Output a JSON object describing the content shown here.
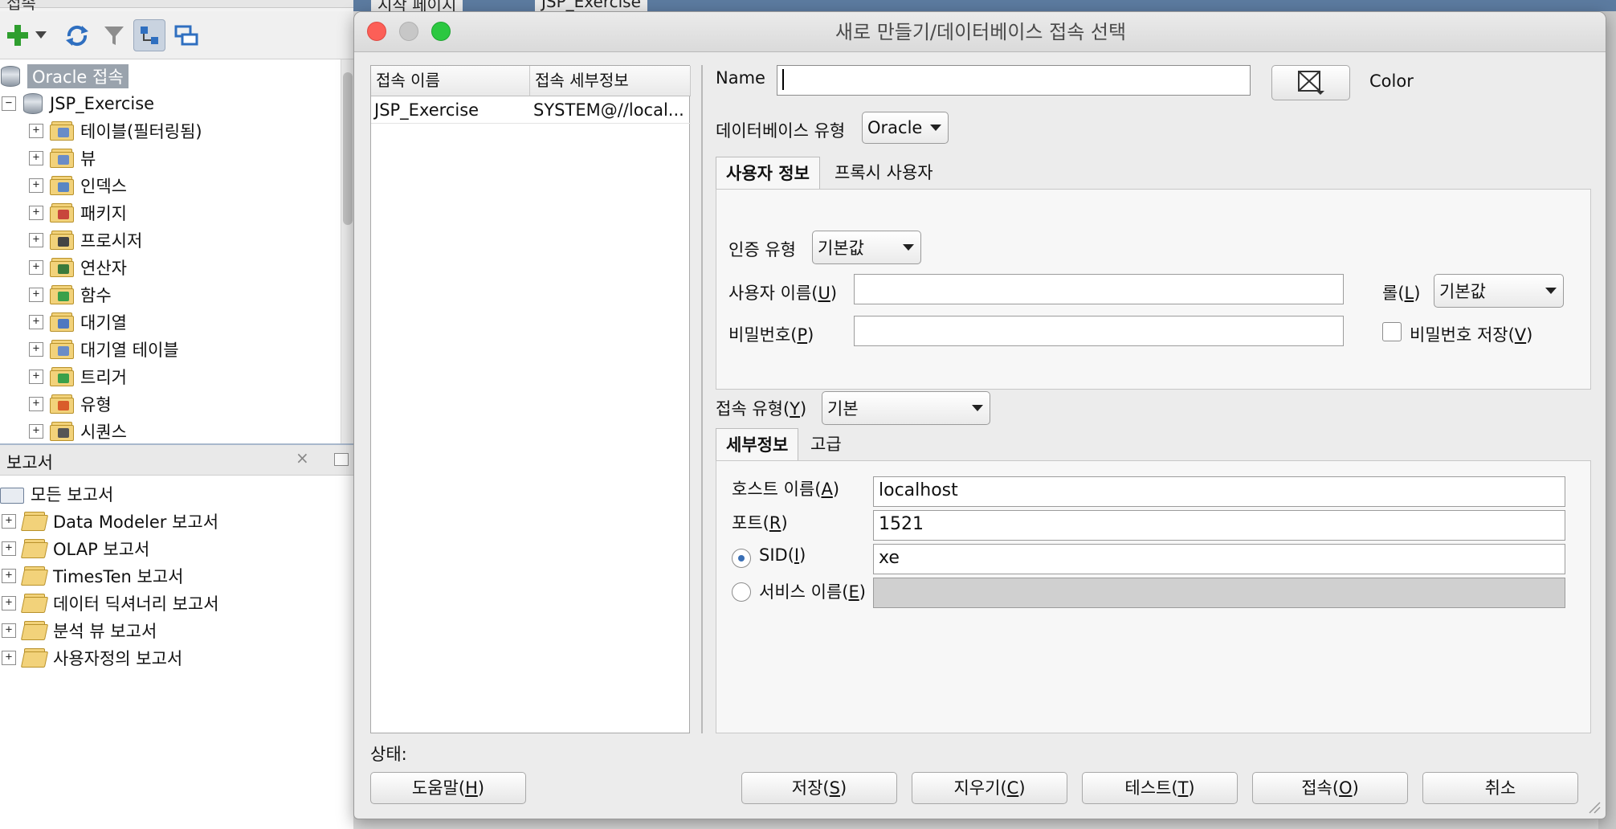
{
  "left_panel": {
    "connections_header": "접속",
    "root": "Oracle 접속",
    "connection": "JSP_Exercise",
    "tree_items": [
      {
        "label": "테이블(필터링됨)",
        "icon": "table-folder-icon",
        "color": "#6a8cc7"
      },
      {
        "label": "뷰",
        "icon": "view-folder-icon",
        "color": "#6a8cc7"
      },
      {
        "label": "인덱스",
        "icon": "index-folder-icon",
        "color": "#5a86c4"
      },
      {
        "label": "패키지",
        "icon": "package-folder-icon",
        "color": "#c8463c"
      },
      {
        "label": "프로시저",
        "icon": "procedure-folder-icon",
        "color": "#444444"
      },
      {
        "label": "연산자",
        "icon": "operator-folder-icon",
        "color": "#3b7a3b"
      },
      {
        "label": "함수",
        "icon": "function-folder-icon",
        "color": "#3aa04a"
      },
      {
        "label": "대기열",
        "icon": "queue-folder-icon",
        "color": "#4f78c0"
      },
      {
        "label": "대기열 테이블",
        "icon": "queue-table-folder-icon",
        "color": "#6a8cc7"
      },
      {
        "label": "트리거",
        "icon": "trigger-folder-icon",
        "color": "#3aa04a"
      },
      {
        "label": "유형",
        "icon": "type-folder-icon",
        "color": "#d95c2a"
      },
      {
        "label": "시퀀스",
        "icon": "sequence-folder-icon",
        "color": "#555555"
      }
    ],
    "reports_title": "보고서",
    "reports_root": "모든 보고서",
    "reports": [
      "Data Modeler 보고서",
      "OLAP 보고서",
      "TimesTen 보고서",
      "데이터 딕셔너리 보고서",
      "분석 뷰 보고서",
      "사용자정의 보고서"
    ]
  },
  "editor_tabs": [
    "시작 페이지",
    "JSP_Exercise"
  ],
  "dialog": {
    "title": "새로 만들기/데이터베이스 접속 선택",
    "table": {
      "columns": [
        "접속 이름",
        "접속 세부정보"
      ],
      "rows": [
        [
          "JSP_Exercise",
          "SYSTEM@//local..."
        ]
      ]
    },
    "name_label": "Name",
    "name_value": "",
    "color_label": "Color",
    "db_type_label": "데이터베이스 유형",
    "db_type_value": "Oracle",
    "user_tabs": [
      "사용자 정보",
      "프록시 사용자"
    ],
    "auth_type_label": "인증 유형",
    "auth_type_value": "기본값",
    "username_label": "사용자 이름(",
    "username_key": "U",
    "role_label": "롤(",
    "role_key": "L",
    "role_value": "기본값",
    "password_label": "비밀번호(",
    "password_key": "P",
    "save_password_label": "비밀번호 저장(",
    "save_password_key": "V",
    "conn_type_label": "접속 유형(",
    "conn_type_key": "Y",
    "conn_type_value": "기본",
    "detail_tabs": [
      "세부정보",
      "고급"
    ],
    "hostname_label": "호스트 이름(",
    "hostname_key": "A",
    "hostname_value": "localhost",
    "port_label": "포트(",
    "port_key": "R",
    "port_value": "1521",
    "sid_label": "SID(",
    "sid_key": "I",
    "sid_value": "xe",
    "service_label": "서비스 이름(",
    "service_key": "E",
    "status_label": "상태:",
    "buttons": {
      "help": "도움말(",
      "help_key": "H",
      "save": "저장(",
      "save_key": "S",
      "clear": "지우기(",
      "clear_key": "C",
      "test": "테스트(",
      "test_key": "T",
      "connect": "접속(",
      "connect_key": "O",
      "cancel": "취소"
    }
  },
  "colors": {
    "close": "#fc5f57",
    "minimize": "#c7c7c7",
    "zoom": "#2bc840",
    "selection": "#3875d7"
  }
}
